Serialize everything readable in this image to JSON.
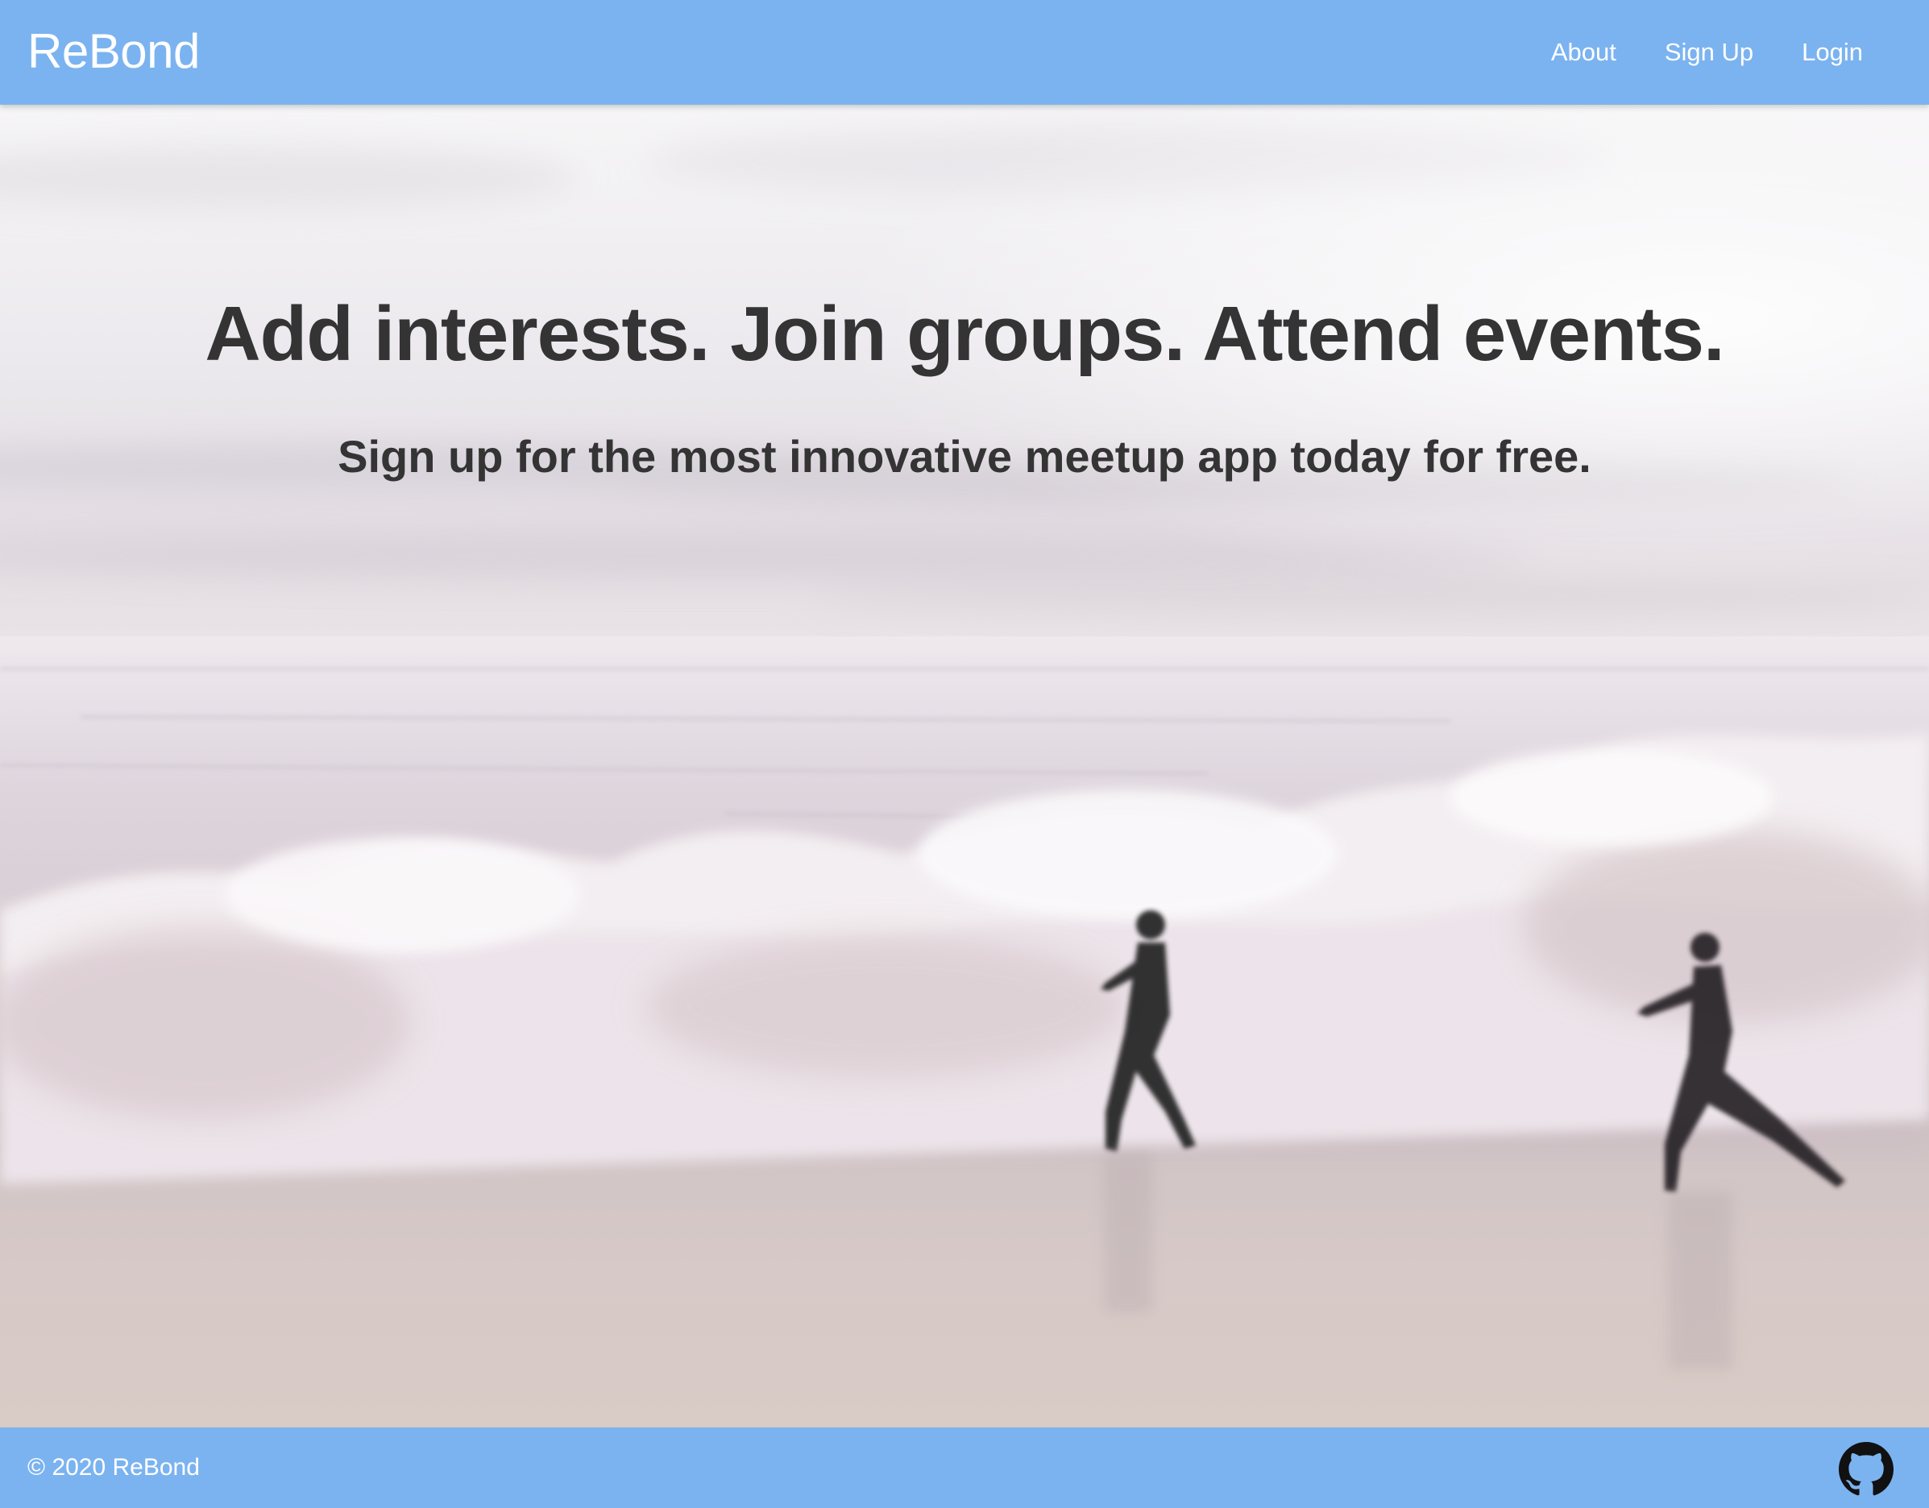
{
  "navbar": {
    "brand": "ReBond",
    "links": [
      "About",
      "Sign Up",
      "Login"
    ]
  },
  "hero": {
    "headline": "Add interests. Join groups. Attend events.",
    "subheadline": "Sign up for the most innovative meetup app today for free.",
    "background_image": "beach-waves-runners-photo"
  },
  "footer": {
    "copyright": "© 2020 ReBond",
    "icon": "github-icon"
  },
  "colors": {
    "navbar_bg": "#7bb3f0",
    "footer_bg": "#7bb3f0",
    "headline_text": "#343434",
    "nav_text": "#ffffff"
  }
}
